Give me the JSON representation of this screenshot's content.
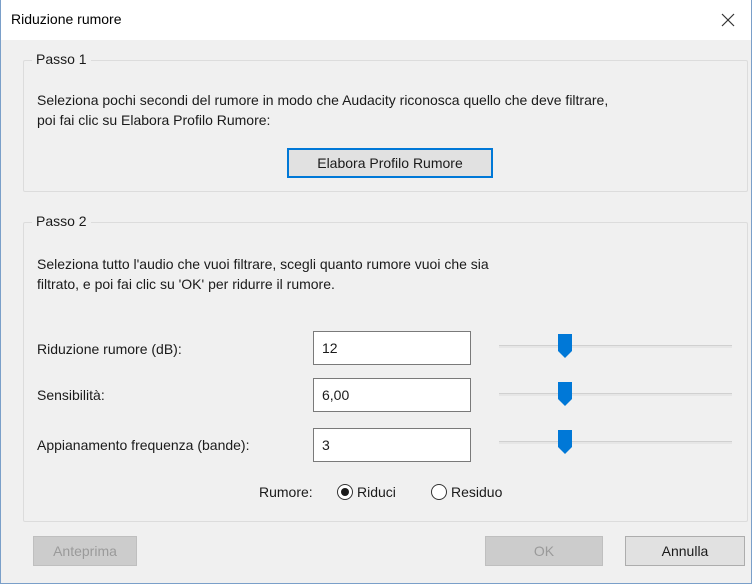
{
  "window": {
    "title": "Riduzione rumore"
  },
  "step1": {
    "label": "Passo 1",
    "description_line1": "Seleziona pochi secondi del rumore in modo che Audacity riconosca quello che deve filtrare,",
    "description_line2": "poi fai clic su Elabora Profilo Rumore:",
    "button_label": "Elabora Profilo Rumore"
  },
  "step2": {
    "label": "Passo 2",
    "description_line1": "Seleziona tutto l'audio che vuoi filtrare, scegli quanto rumore vuoi che sia",
    "description_line2": "filtrato, e poi fai clic su 'OK' per ridurre il rumore.",
    "rows": [
      {
        "label": "Riduzione rumore (dB):",
        "value": "12",
        "slider_fraction": 0.27
      },
      {
        "label": "Sensibilità:",
        "value": "6,00",
        "slider_fraction": 0.27
      },
      {
        "label": "Appianamento frequenza (bande):",
        "value": "3",
        "slider_fraction": 0.27
      }
    ],
    "noise": {
      "label": "Rumore:",
      "options": [
        "Riduci",
        "Residuo"
      ],
      "selected": "Riduci"
    }
  },
  "footer": {
    "preview_label": "Anteprima",
    "ok_label": "OK",
    "cancel_label": "Annulla"
  },
  "icons": {
    "close": "close-icon"
  },
  "colors": {
    "focus_border": "#0078d7",
    "slider_thumb": "#0078d7"
  }
}
